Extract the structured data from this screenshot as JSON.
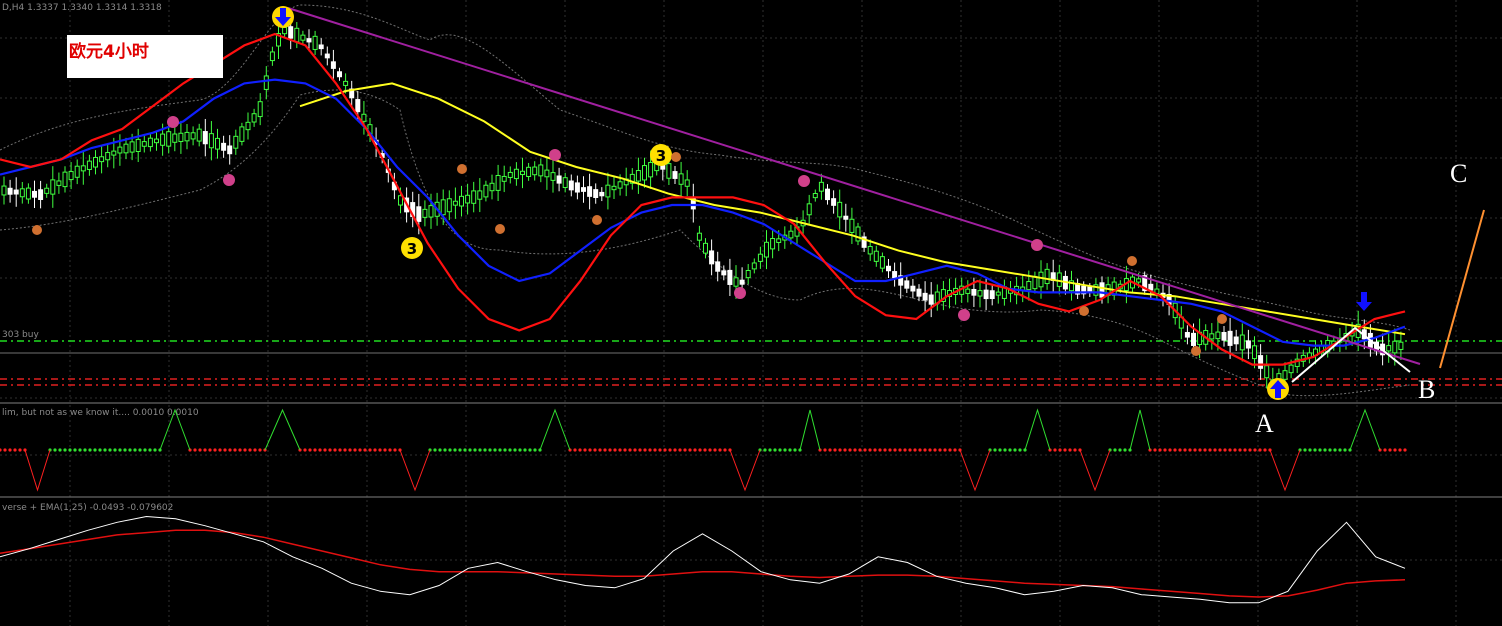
{
  "header": {
    "symbol_text": "D,H4  1.3337 1.3340 1.3314 1.3318",
    "osc1_text": "lim, but not as we know it....  0.0010 0.0010",
    "osc2_text": "verse + EMA(1,25) -0.0493 -0.079602",
    "level_text": "303 buy"
  },
  "title_label": "欧元4小时",
  "wave_labels": {
    "a": "A",
    "b": "B",
    "c": "C"
  },
  "markers": {
    "number": "3",
    "dot": "1",
    "circle": "2"
  },
  "colors": {
    "background": "#000000",
    "bull_candle": "#40ff40",
    "bear_candle": "#ffffff",
    "red_ma": "#ff1010",
    "blue_ma": "#1020ff",
    "yellow_ma": "#ffff20",
    "trend_line": "#a020a0",
    "envelope": "#808080",
    "green_level": "#20dd20",
    "red_level": "#e02020",
    "forecast": "#ff9030",
    "wave_lines": "#ffffff"
  },
  "chart_data": {
    "type": "candlestick",
    "price_ma_red": [
      0.62,
      0.6,
      0.62,
      0.67,
      0.7,
      0.76,
      0.82,
      0.87,
      0.92,
      0.95,
      0.92,
      0.82,
      0.7,
      0.55,
      0.4,
      0.28,
      0.2,
      0.17,
      0.2,
      0.3,
      0.42,
      0.5,
      0.52,
      0.52,
      0.52,
      0.5,
      0.45,
      0.35,
      0.26,
      0.21,
      0.2,
      0.26,
      0.3,
      0.28,
      0.24,
      0.22,
      0.25,
      0.3,
      0.26,
      0.18,
      0.12,
      0.08,
      0.08,
      0.1,
      0.15,
      0.2,
      0.22
    ],
    "price_ma_blue": [
      0.58,
      0.6,
      0.62,
      0.65,
      0.67,
      0.69,
      0.72,
      0.78,
      0.82,
      0.83,
      0.82,
      0.78,
      0.7,
      0.6,
      0.52,
      0.42,
      0.34,
      0.3,
      0.32,
      0.38,
      0.44,
      0.48,
      0.5,
      0.5,
      0.48,
      0.45,
      0.4,
      0.35,
      0.3,
      0.3,
      0.32,
      0.34,
      0.32,
      0.28,
      0.27,
      0.27,
      0.27,
      0.26,
      0.25,
      0.24,
      0.22,
      0.18,
      0.14,
      0.13,
      0.13,
      0.15,
      0.18
    ],
    "price_ma_yellow": [
      0.76,
      0.8,
      0.82,
      0.78,
      0.72,
      0.64,
      0.6,
      0.57,
      0.53,
      0.5,
      0.48,
      0.45,
      0.42,
      0.38,
      0.35,
      0.33,
      0.31,
      0.29,
      0.27,
      0.26,
      0.24,
      0.22,
      0.2,
      0.18,
      0.16
    ],
    "osc1_steps": [
      0,
      0,
      0,
      -1,
      0,
      0,
      1,
      0,
      0,
      0,
      -1,
      0,
      1,
      0,
      0,
      0,
      -1,
      0,
      0,
      1,
      0,
      0,
      0,
      -1,
      0,
      1,
      0,
      0,
      0,
      -1,
      0,
      0,
      0,
      1,
      0,
      0,
      -1,
      0,
      1,
      0,
      0,
      0,
      -1,
      0,
      0,
      1,
      0,
      0
    ],
    "osc2_line": [
      0.55,
      0.62,
      0.7,
      0.78,
      0.85,
      0.9,
      0.88,
      0.82,
      0.75,
      0.68,
      0.55,
      0.45,
      0.32,
      0.25,
      0.22,
      0.3,
      0.45,
      0.5,
      0.42,
      0.35,
      0.3,
      0.28,
      0.36,
      0.6,
      0.75,
      0.6,
      0.42,
      0.35,
      0.32,
      0.4,
      0.55,
      0.5,
      0.38,
      0.32,
      0.28,
      0.22,
      0.25,
      0.3,
      0.28,
      0.22,
      0.2,
      0.18,
      0.15,
      0.15,
      0.25,
      0.6,
      0.85,
      0.55,
      0.45
    ],
    "osc2_ema": [
      0.58,
      0.62,
      0.66,
      0.7,
      0.74,
      0.76,
      0.78,
      0.78,
      0.76,
      0.72,
      0.66,
      0.6,
      0.54,
      0.48,
      0.44,
      0.42,
      0.42,
      0.42,
      0.41,
      0.4,
      0.39,
      0.38,
      0.38,
      0.4,
      0.42,
      0.42,
      0.4,
      0.38,
      0.37,
      0.38,
      0.39,
      0.39,
      0.38,
      0.36,
      0.34,
      0.32,
      0.31,
      0.3,
      0.29,
      0.27,
      0.25,
      0.23,
      0.21,
      0.2,
      0.21,
      0.26,
      0.32,
      0.34,
      0.35
    ]
  }
}
